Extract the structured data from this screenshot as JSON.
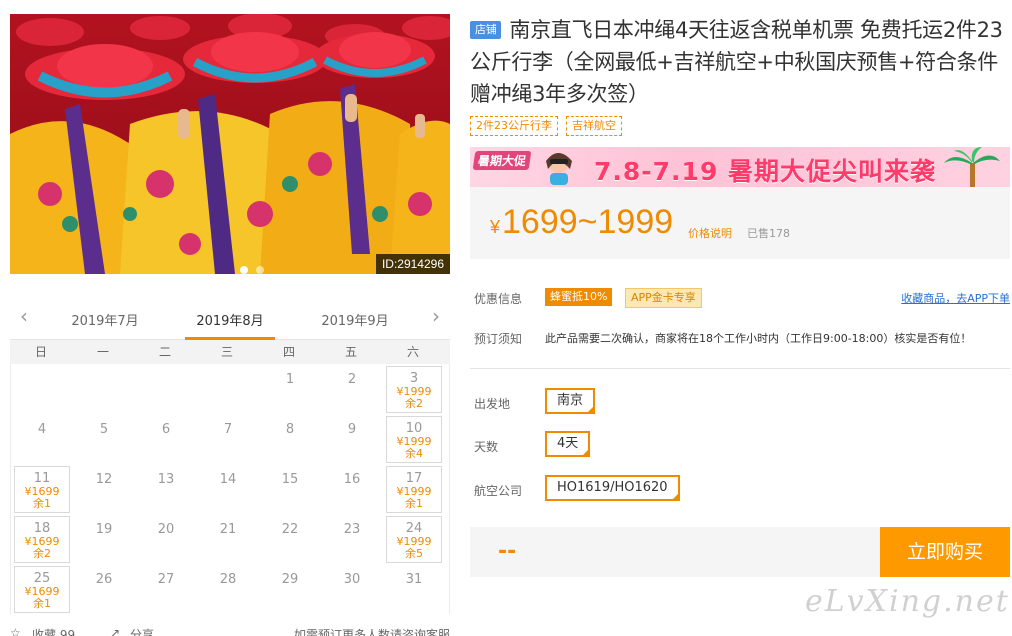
{
  "hero": {
    "id_text": "ID:2914296",
    "slide_count": 3,
    "active_slide": 1
  },
  "calendar": {
    "prev_month": "2019年7月",
    "current_month": "2019年8月",
    "next_month": "2019年9月",
    "weekdays": [
      "日",
      "一",
      "二",
      "三",
      "四",
      "五",
      "六"
    ],
    "weeks": [
      [
        null,
        null,
        null,
        null,
        {
          "day": "1"
        },
        {
          "day": "2"
        },
        {
          "day": "3",
          "price": "¥1999",
          "rest": "余2"
        }
      ],
      [
        {
          "day": "4"
        },
        {
          "day": "5"
        },
        {
          "day": "6"
        },
        {
          "day": "7"
        },
        {
          "day": "8"
        },
        {
          "day": "9"
        },
        {
          "day": "10",
          "price": "¥1999",
          "rest": "余4"
        }
      ],
      [
        {
          "day": "11",
          "price": "¥1699",
          "rest": "余1"
        },
        {
          "day": "12"
        },
        {
          "day": "13"
        },
        {
          "day": "14"
        },
        {
          "day": "15"
        },
        {
          "day": "16"
        },
        {
          "day": "17",
          "price": "¥1999",
          "rest": "余1"
        }
      ],
      [
        {
          "day": "18",
          "price": "¥1699",
          "rest": "余2"
        },
        {
          "day": "19"
        },
        {
          "day": "20"
        },
        {
          "day": "21"
        },
        {
          "day": "22"
        },
        {
          "day": "23"
        },
        {
          "day": "24",
          "price": "¥1999",
          "rest": "余5"
        }
      ],
      [
        {
          "day": "25",
          "price": "¥1699",
          "rest": "余1"
        },
        {
          "day": "26"
        },
        {
          "day": "27"
        },
        {
          "day": "28"
        },
        {
          "day": "29"
        },
        {
          "day": "30"
        },
        {
          "day": "31"
        }
      ]
    ],
    "footer": {
      "favorite": "收藏 99",
      "share": "分享",
      "note": "如需预订更多人数请咨询客服"
    }
  },
  "product": {
    "store_tag": "店铺",
    "title": "南京直飞日本冲绳4天往返含税单机票 免费托运2件23公斤行李（全网最低+吉祥航空+中秋国庆预售+符合条件赠冲绳3年多次签）",
    "tags": [
      "2件23公斤行李",
      "吉祥航空"
    ],
    "promo": {
      "badge": "暑期大促",
      "text": "7.8-7.19 暑期大促尖叫来袭"
    },
    "price": {
      "currency": "¥",
      "range": "1699~1999",
      "note": "价格说明",
      "sold": "已售178"
    },
    "discount": {
      "label": "优惠信息",
      "honey": "蜂蜜抵10%",
      "app": "APP金卡专享",
      "fav_link": "收藏商品，去APP下单"
    },
    "booking": {
      "label": "预订须知",
      "text": "此产品需要二次确认，商家将在18个工作小时内（工作日9:00-18:00）核实是否有位！"
    },
    "options": {
      "departure_label": "出发地",
      "departure_value": "南京",
      "days_label": "天数",
      "days_value": "4天",
      "airline_label": "航空公司",
      "airline_value": "HO1619/HO1620"
    },
    "buy": {
      "total": "--",
      "button": "立即购买"
    }
  },
  "watermark": "eLvXing.net",
  "colors": {
    "accent": "#f08a00",
    "buy_button": "#ff9900",
    "store_tag": "#4a90e2",
    "link": "#2a6fd6"
  }
}
